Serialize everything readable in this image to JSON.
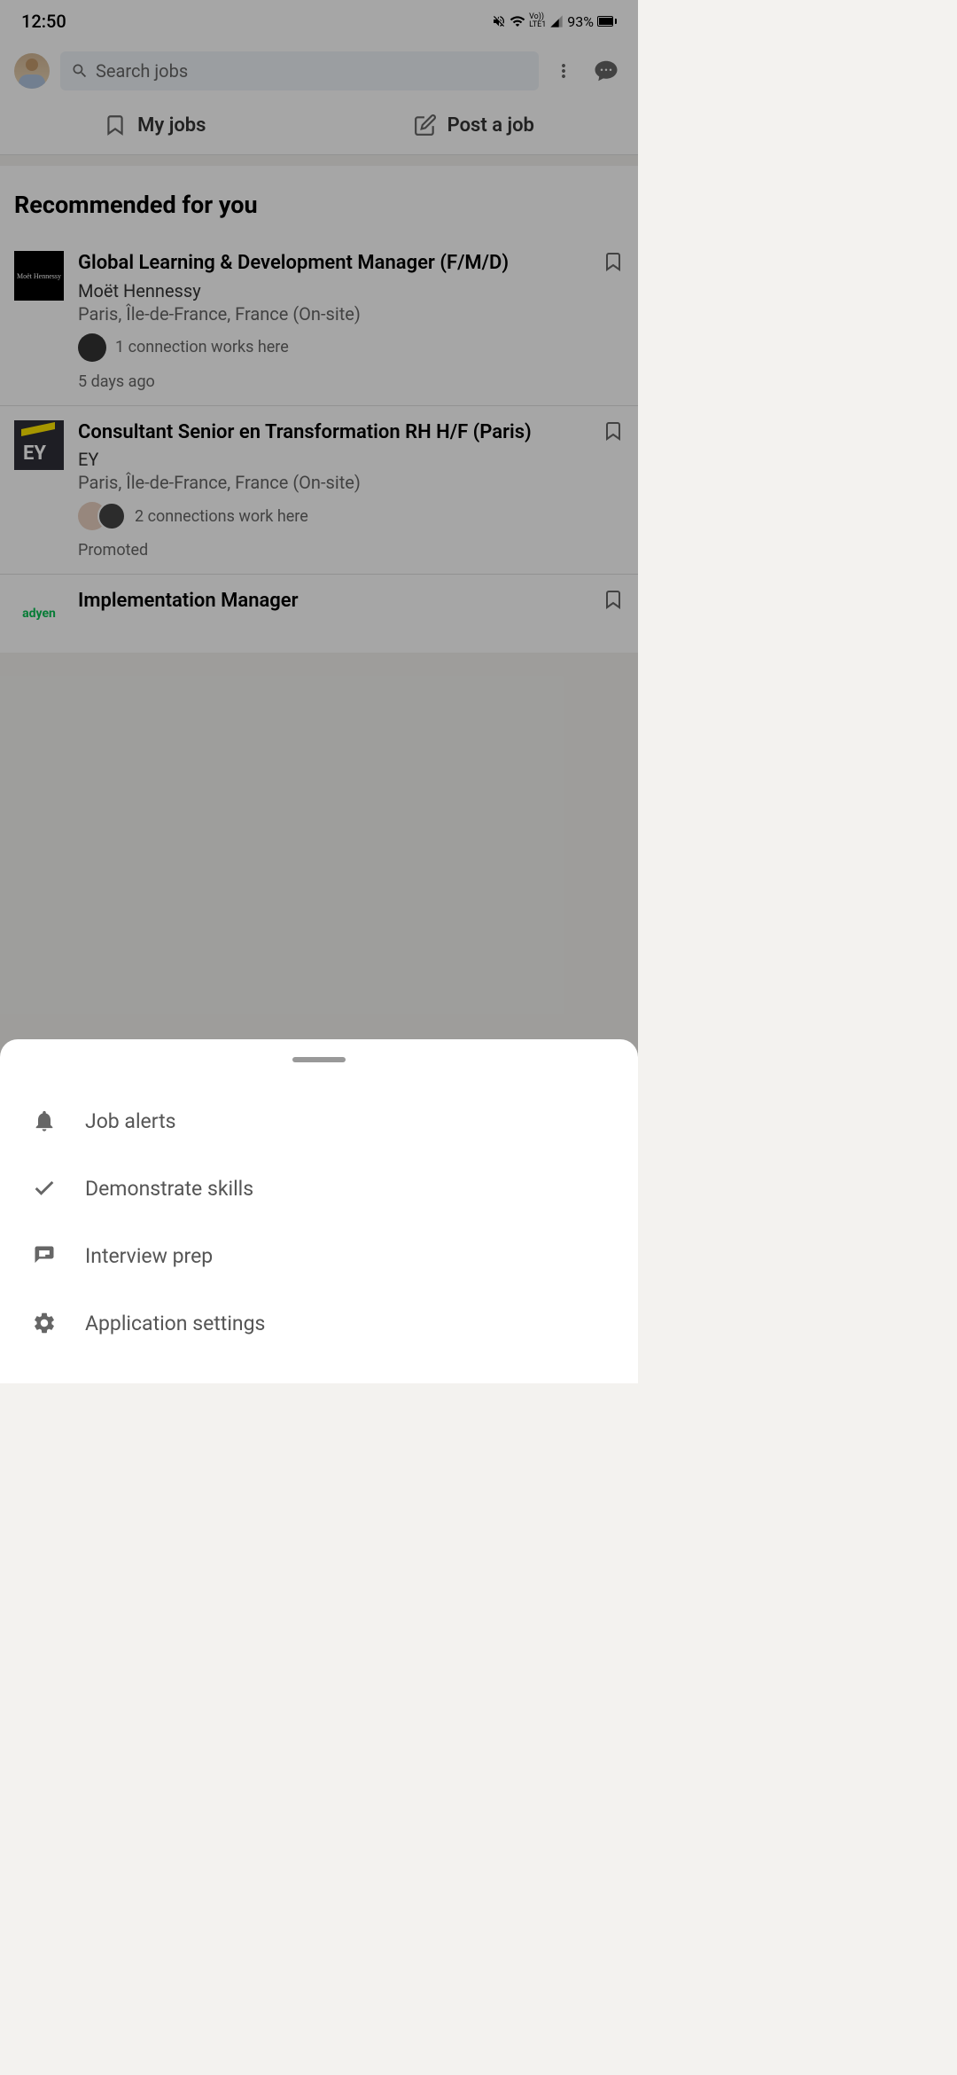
{
  "status": {
    "time": "12:50",
    "battery": "93%"
  },
  "header": {
    "search_placeholder": "Search jobs"
  },
  "tabs": {
    "my_jobs": "My jobs",
    "post_job": "Post a job"
  },
  "section": {
    "title": "Recommended for you"
  },
  "jobs": [
    {
      "title": "Global Learning & Development Manager (F/M/D)",
      "company": "Moët Hennessy",
      "location": "Paris, Île-de-France, France (On-site)",
      "connections": "1 connection works here",
      "meta": "5 days ago",
      "logo_text": "Moët Hennessy"
    },
    {
      "title": "Consultant Senior en Transformation RH H/F (Paris)",
      "company": "EY",
      "location": "Paris, Île-de-France, France (On-site)",
      "connections": "2 connections work here",
      "meta": "Promoted",
      "logo_text": "EY"
    },
    {
      "title": "Implementation Manager",
      "company": "Adyen",
      "location": "",
      "connections": "",
      "meta": "",
      "logo_text": "adyen"
    }
  ],
  "sheet": {
    "items": [
      {
        "label": "Job alerts"
      },
      {
        "label": "Demonstrate skills"
      },
      {
        "label": "Interview prep"
      },
      {
        "label": "Application settings"
      }
    ]
  }
}
